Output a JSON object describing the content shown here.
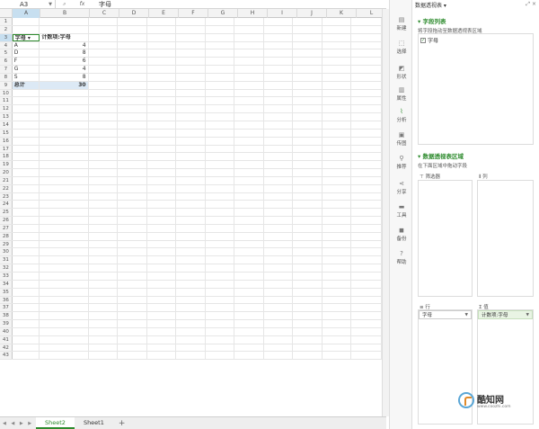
{
  "formula_bar": {
    "cell_ref": "A3",
    "fx": "fx",
    "content": "字母",
    "zoom_icon": "magnifier",
    "cancel_icon": "×"
  },
  "columns": [
    "A",
    "B",
    "C",
    "D",
    "E",
    "F",
    "G",
    "H",
    "I",
    "J",
    "K",
    "L"
  ],
  "rows": [
    "1",
    "2",
    "3",
    "4",
    "5",
    "6",
    "7",
    "8",
    "9",
    "10",
    "11",
    "12",
    "13",
    "14",
    "15",
    "16",
    "17",
    "18",
    "19",
    "20",
    "21",
    "22",
    "23",
    "24",
    "25",
    "26",
    "27",
    "28",
    "29",
    "30",
    "31",
    "32",
    "33",
    "34",
    "35",
    "36",
    "37",
    "38",
    "39",
    "40",
    "41",
    "42",
    "43"
  ],
  "pivot": {
    "header_a": "字母",
    "header_b": "计数项:字母",
    "items": [
      {
        "k": "A",
        "v": "4"
      },
      {
        "k": "D",
        "v": "8"
      },
      {
        "k": "F",
        "v": "6"
      },
      {
        "k": "G",
        "v": "4"
      },
      {
        "k": "S",
        "v": "8"
      }
    ],
    "total_label": "总计",
    "total_value": "30"
  },
  "sheets": {
    "tabs": [
      "Sheet2",
      "Sheet1"
    ],
    "active": "Sheet2",
    "add": "+"
  },
  "toolbar": [
    {
      "label": "新建",
      "icon": "doc-icon"
    },
    {
      "label": "选择",
      "icon": "select-icon"
    },
    {
      "label": "形状",
      "icon": "shape-icon"
    },
    {
      "label": "属性",
      "icon": "property-icon"
    },
    {
      "label": "分析",
      "icon": "analysis-icon"
    },
    {
      "label": "传图",
      "icon": "image-icon"
    },
    {
      "label": "推荐",
      "icon": "location-icon"
    },
    {
      "label": "分享",
      "icon": "share-icon"
    },
    {
      "label": "工具",
      "icon": "toolbox-icon"
    },
    {
      "label": "备份",
      "icon": "backup-icon"
    },
    {
      "label": "帮助",
      "icon": "help-icon"
    }
  ],
  "panel": {
    "title": "数据透视表 ▾",
    "field_list_title": "字段列表",
    "field_hint": "将字段拖动至数据透视表区域",
    "field_item": "字母",
    "area_title": "数据透视表区域",
    "area_hint": "在下面区域中拖动字段",
    "filter_label": "筛选器",
    "col_label": "列",
    "row_label": "行",
    "value_label": "值",
    "row_chip": "字母",
    "value_chip": "计数项:字母"
  },
  "watermark": {
    "name": "酷知网",
    "url": "www.coozhi.com"
  },
  "colors": {
    "accent": "#2e8b2e",
    "total_row": "#dce9f5",
    "selected_header": "#c7dff0"
  }
}
